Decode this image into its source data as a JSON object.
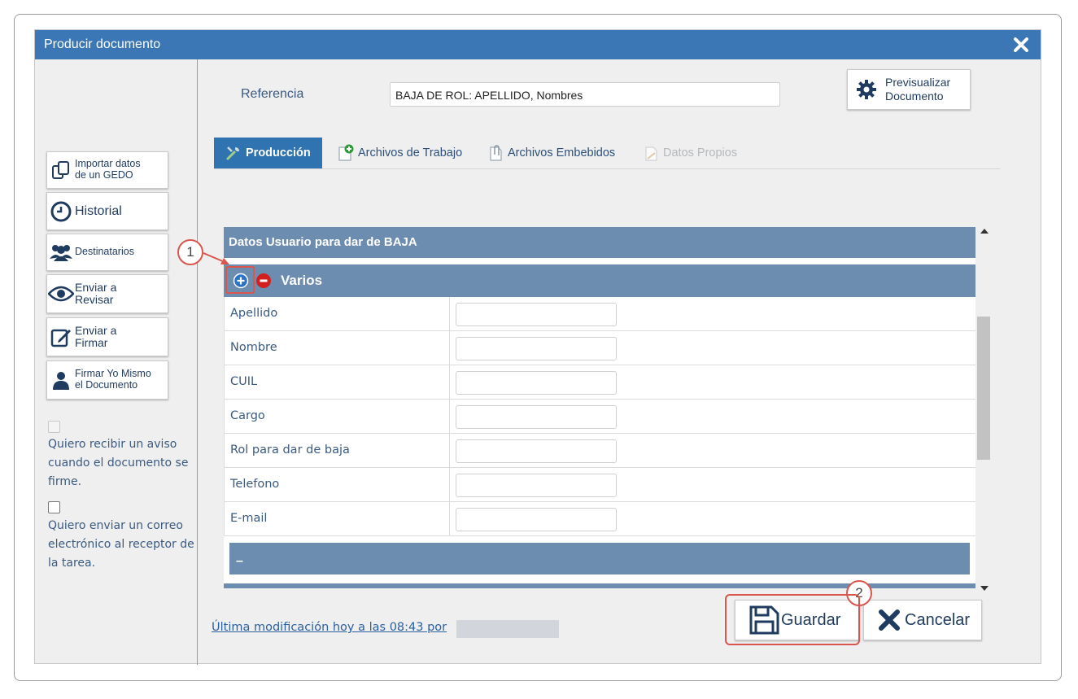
{
  "window": {
    "title": "Producir documento"
  },
  "sidebar": {
    "buttons": [
      {
        "id": "importar",
        "label_1": "Importar datos",
        "label_2": "de un GEDO",
        "icon": "copy-icon"
      },
      {
        "id": "historial",
        "label": "Historial",
        "icon": "clock-icon"
      },
      {
        "id": "destinatarios",
        "label": "Destinatarios",
        "icon": "users-icon"
      },
      {
        "id": "revisar",
        "label_1": "Enviar a",
        "label_2": "Revisar",
        "icon": "eye-icon"
      },
      {
        "id": "firmar",
        "label_1": "Enviar a",
        "label_2": "Firmar",
        "icon": "edit-icon"
      },
      {
        "id": "firmar-yo",
        "label_1": "Firmar Yo Mismo",
        "label_2": "el Documento",
        "icon": "user-icon"
      }
    ],
    "checkboxes": [
      {
        "text": "Quiero recibir un aviso cuando el documento se firme.",
        "disabled": true,
        "checked": false
      },
      {
        "text": "Quiero enviar un correo electrónico al receptor de la tarea.",
        "disabled": false,
        "checked": false
      }
    ]
  },
  "reference": {
    "label": "Referencia",
    "value": "BAJA DE ROL: APELLIDO, Nombres"
  },
  "preview_button": {
    "label_1": "Previsualizar",
    "label_2": "Documento"
  },
  "tabs": [
    {
      "label": "Producción",
      "active": true,
      "icon": "wrench-icon"
    },
    {
      "label": "Archivos de Trabajo",
      "active": false,
      "icon": "file-add-icon"
    },
    {
      "label": "Archivos Embebidos",
      "active": false,
      "icon": "paperclip-icon"
    },
    {
      "label": "Datos Propios",
      "active": false,
      "disabled": true,
      "icon": "document-icon"
    }
  ],
  "form": {
    "section_title": "Datos Usuario para dar de BAJA",
    "group_title": "Varios",
    "fields": [
      {
        "label": "Apellido",
        "value": ""
      },
      {
        "label": "Nombre",
        "value": ""
      },
      {
        "label": "CUIL",
        "value": ""
      },
      {
        "label": "Cargo",
        "value": ""
      },
      {
        "label": "Rol para dar de baja",
        "value": ""
      },
      {
        "label": "Telefono",
        "value": ""
      },
      {
        "label": "E-mail",
        "value": ""
      }
    ],
    "footer_text": "–"
  },
  "footer": {
    "last_modified": "Última modificación hoy a las 08:43 por",
    "save_label": "Guardar",
    "cancel_label": "Cancelar"
  },
  "callouts": {
    "one": "1",
    "two": "2"
  },
  "colors": {
    "title_bar": "#3b77b5",
    "section_header": "#6d8db0",
    "active_tab": "#2f74b0",
    "callout": "#d9564e"
  }
}
